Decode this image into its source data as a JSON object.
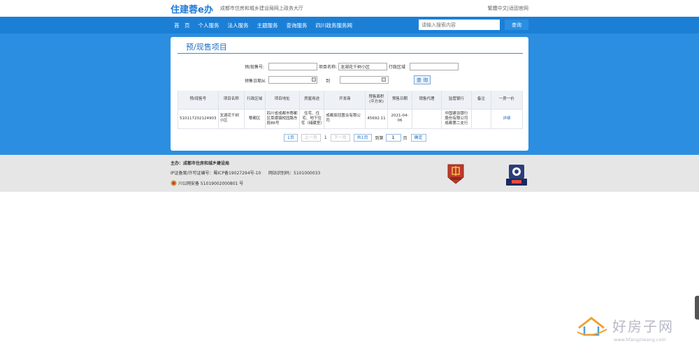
{
  "header": {
    "logo": "住建蓉e办",
    "subtitle": "成都市住房和城乡建设局网上政务大厅",
    "links": "繁體中文|适固官网"
  },
  "nav": {
    "items": [
      "首　页",
      "个人服务",
      "法人服务",
      "主题服务",
      "查询服务",
      "四川政务服务网"
    ],
    "search_placeholder": "请输入搜索内容",
    "search_button": "查询"
  },
  "page": {
    "title": "预/现售项目"
  },
  "form": {
    "permit_no_label": "预/现售号:",
    "permit_no_value": "",
    "project_name_label": "项目名称:",
    "project_name_value": "龙湖花千树小区",
    "district_label": "行政区域",
    "district_value": "",
    "date_label": "预售日期从",
    "date_from_value": "",
    "to_label": "到",
    "date_to_value": "",
    "query_button": "查 询"
  },
  "table": {
    "headers": [
      "预/现售号",
      "项目名称",
      "行政区域",
      "项目地址",
      "房屋用途",
      "开发商",
      "预售面积(平方米)",
      "预售日期",
      "销售代理",
      "监管银行",
      "备注",
      "一房一价"
    ],
    "rows": [
      {
        "permit_no": "510117202124903",
        "project_name": "龙湖花千树小区",
        "district": "郫都区",
        "address": "四川省成都市郫都区菜甫镇校园路东段86号",
        "usage": "住宅、住宅、地下住宅（储藏室）",
        "developer": "成都辰冠置业有限公司",
        "area": "45692.11",
        "date": "2021-04-06",
        "agent": "",
        "bank": "中国建设银行股份有限公司成都第二支行",
        "remark": "",
        "price_link": "详细"
      }
    ]
  },
  "pager": {
    "first": "1页",
    "prev": "上一页",
    "current": "1",
    "next": "下一页",
    "total": "共1页",
    "goto_prefix": "到第",
    "goto_value": "1",
    "goto_suffix": "页",
    "confirm": "确定"
  },
  "footer": {
    "host": "主办：成都市住房和城乡建设局",
    "icp": "IP证备案/许可证编号：蜀ICP备19027294号-10",
    "site_code": "网站识别码：5101000033",
    "police": "川公网安备 51019002000801 号"
  },
  "watermark": {
    "text": "好房子网",
    "url": "www.hfangziwang.com"
  },
  "colors": {
    "nav_bar": "#1c7fd6",
    "band": "#2b8ee0",
    "footer": "#e6e6e6",
    "link": "#1f6fc4"
  }
}
